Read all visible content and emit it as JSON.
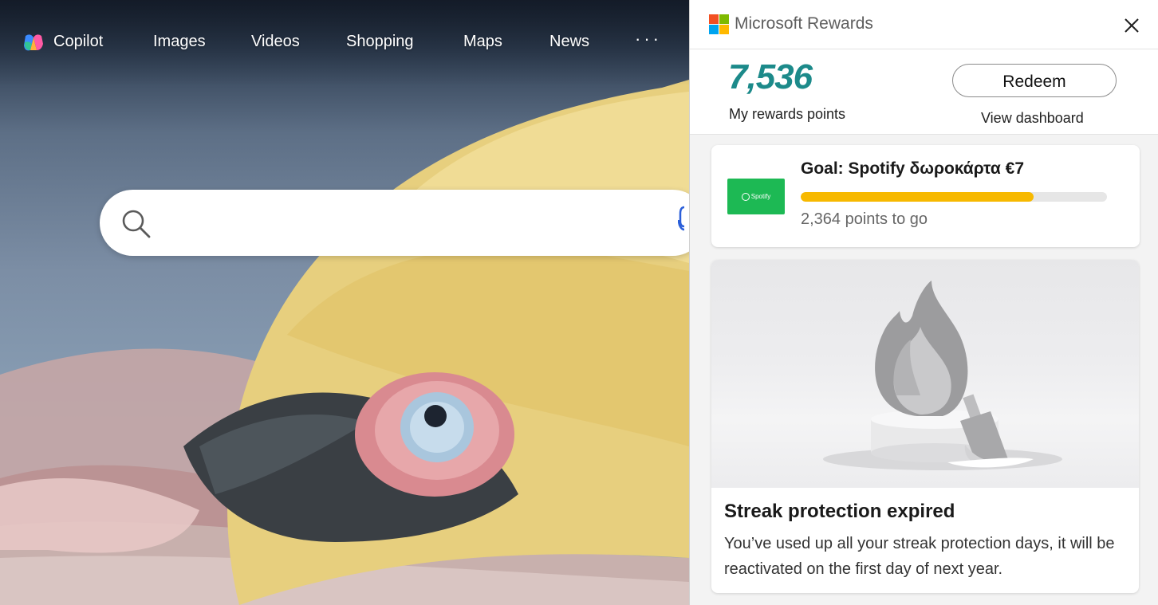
{
  "nav": {
    "items": [
      {
        "label": "Copilot"
      },
      {
        "label": "Images"
      },
      {
        "label": "Videos"
      },
      {
        "label": "Shopping"
      },
      {
        "label": "Maps"
      },
      {
        "label": "News"
      }
    ],
    "more_label": "···"
  },
  "search": {
    "value": "",
    "placeholder": ""
  },
  "panel": {
    "title": "Microsoft Rewards",
    "points_value": "7,536",
    "points_label": "My rewards points",
    "redeem_label": "Redeem",
    "view_dashboard_label": "View dashboard",
    "goal": {
      "title": "Goal: Spotify δωροκάρτα €7",
      "thumb_label": "Spotify",
      "progress_fraction": 0.76,
      "subtitle": "2,364 points to go"
    },
    "streak": {
      "title": "Streak protection expired",
      "body": "You’ve used up all your streak protection days, it will be reactivated on the first day of next year."
    }
  },
  "colors": {
    "points_accent": "#1c8a8a",
    "progress_fill": "#f7b900",
    "spotify_green": "#1db954",
    "ms_red": "#f25022",
    "ms_green": "#7fba00",
    "ms_blue": "#00a4ef",
    "ms_yellow": "#ffb900"
  },
  "icons": {
    "copilot": "copilot-icon",
    "search": "search-icon",
    "mic": "microphone-icon",
    "close": "close-icon",
    "more": "more-horizontal-icon",
    "flame": "flame-icon"
  }
}
